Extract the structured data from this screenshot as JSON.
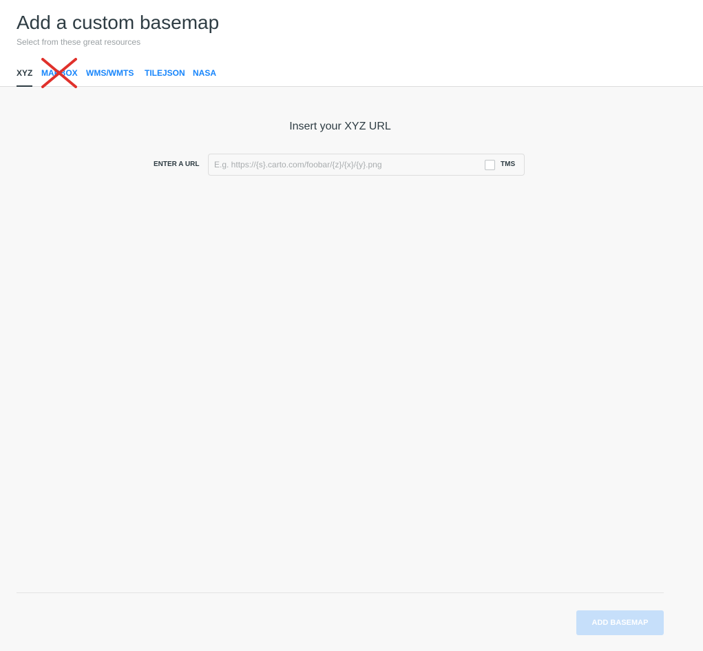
{
  "header": {
    "title": "Add a custom basemap",
    "subtitle": "Select from these great resources"
  },
  "tabs": [
    {
      "label": "XYZ",
      "active": true
    },
    {
      "label": "MAPBOX",
      "active": false,
      "crossed_out": true
    },
    {
      "label": "WMS/WMTS",
      "active": false
    },
    {
      "label": "TILEJSON",
      "active": false
    },
    {
      "label": "NASA",
      "active": false
    }
  ],
  "annotation": {
    "icon": "red-cross-mark-icon",
    "color": "#e0312b"
  },
  "main": {
    "section_title": "Insert your XYZ URL",
    "url_label": "ENTER A URL",
    "url_value": "",
    "url_placeholder": "E.g. https://{s}.carto.com/foobar/{z}/{x}/{y}.png",
    "tms_label": "TMS",
    "tms_checked": false
  },
  "footer": {
    "add_button_label": "ADD BASEMAP",
    "add_button_enabled": false
  },
  "colors": {
    "accent": "#1785fb",
    "disabled_button": "#c6dffa",
    "text": "#2e3c43"
  }
}
